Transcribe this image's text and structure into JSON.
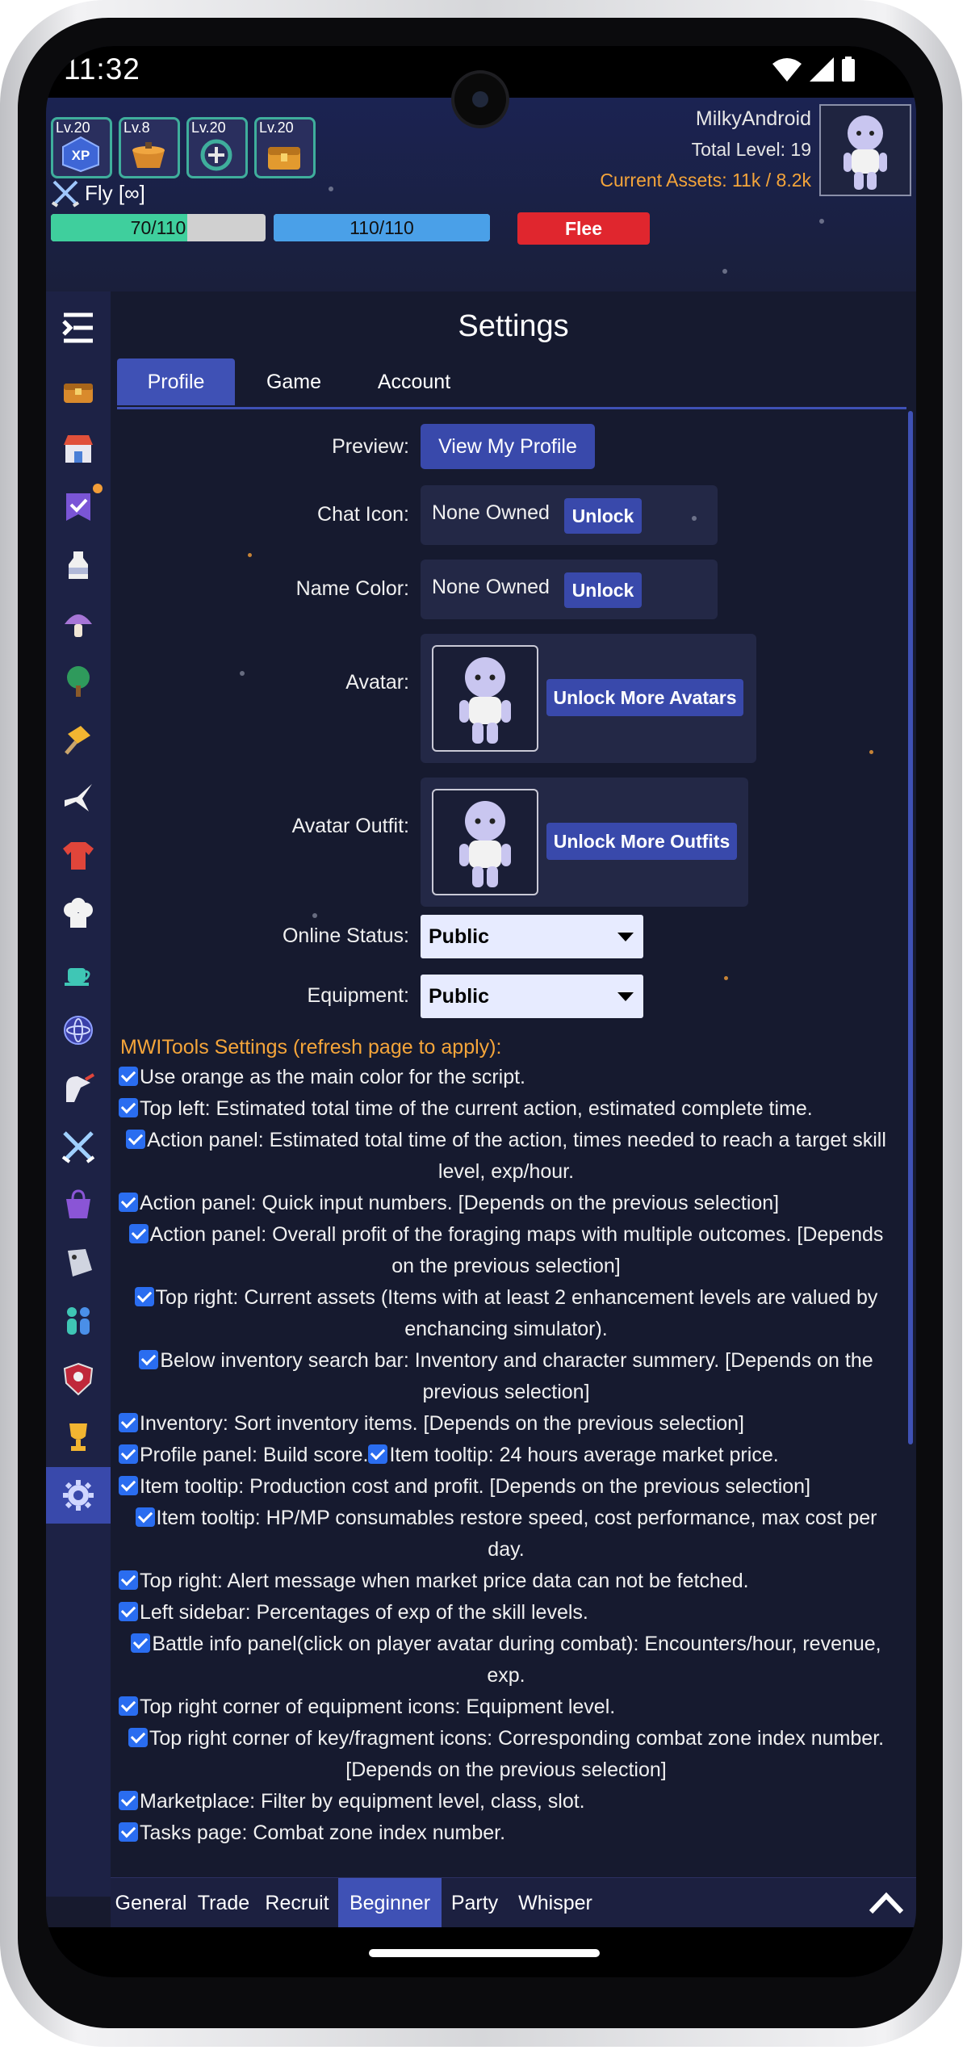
{
  "status_bar": {
    "time": "11:32"
  },
  "skills": [
    {
      "level": "Lv.20",
      "icon": "xp-icon"
    },
    {
      "level": "Lv.8",
      "icon": "cooking-pot-icon"
    },
    {
      "level": "Lv.20",
      "icon": "loop-arrow-icon"
    },
    {
      "level": "Lv.20",
      "icon": "treasure-chest-icon"
    }
  ],
  "player": {
    "name": "MilkyAndroid",
    "total_level": "Total Level: 19",
    "assets": "Current Assets: 11k / 8.2k"
  },
  "action": {
    "label": "Fly [∞]"
  },
  "bars": {
    "hp_text": "70/110",
    "hp_fraction": 0.636,
    "mp_text": "110/110",
    "mp_fraction": 1.0,
    "flee_label": "Flee"
  },
  "sidebar": [
    {
      "icon": "menu-collapse-icon"
    },
    {
      "icon": "inventory-chest-icon"
    },
    {
      "icon": "marketplace-icon"
    },
    {
      "icon": "tasks-banner-icon",
      "badge": true
    },
    {
      "icon": "milking-icon"
    },
    {
      "icon": "foraging-icon"
    },
    {
      "icon": "woodcutting-icon"
    },
    {
      "icon": "cheesesmithing-icon"
    },
    {
      "icon": "crafting-icon"
    },
    {
      "icon": "tailoring-icon"
    },
    {
      "icon": "cooking-icon"
    },
    {
      "icon": "brewing-icon"
    },
    {
      "icon": "alchemy-icon"
    },
    {
      "icon": "enhancing-icon"
    },
    {
      "icon": "combat-icon"
    },
    {
      "icon": "shop-icon"
    },
    {
      "icon": "cowbell-store-icon"
    },
    {
      "icon": "social-icon"
    },
    {
      "icon": "guild-icon"
    },
    {
      "icon": "leaderboard-icon"
    },
    {
      "icon": "settings-gear-icon",
      "active": true
    }
  ],
  "settings": {
    "title": "Settings",
    "tabs": [
      "Profile",
      "Game",
      "Account"
    ],
    "preview_label": "Preview:",
    "view_profile_button": "View My Profile",
    "chat_icon_label": "Chat Icon:",
    "chat_icon_value": "None Owned",
    "name_color_label": "Name Color:",
    "name_color_value": "None Owned",
    "unlock_label": "Unlock",
    "avatar_label": "Avatar:",
    "unlock_avatars_button": "Unlock More Avatars",
    "avatar_outfit_label": "Avatar Outfit:",
    "unlock_outfits_button": "Unlock More Outfits",
    "online_status_label": "Online Status:",
    "online_status_value": "Public",
    "equipment_label": "Equipment:",
    "equipment_value": "Public"
  },
  "mwitools": {
    "title": "MWITools Settings (refresh page to apply):",
    "options": [
      "Use orange as the main color for the script.",
      "Top left: Estimated total time of the current action, estimated complete time.",
      "Action panel: Estimated total time of the action, times needed to reach a target skill level, exp/hour.",
      "Action panel: Quick input numbers. [Depends on the previous selection]",
      "Action panel: Overall profit of the foraging maps with multiple outcomes. [Depends on the previous selection]",
      "Top right: Current assets (Items with at least 2 enhancement levels are valued by enchancing simulator).",
      "Below inventory search bar: Inventory and character summery. [Depends on the previous selection]",
      "Inventory: Sort inventory items. [Depends on the previous selection]",
      "Profile panel: Build score.",
      "Item tooltip: 24 hours average market price.",
      "Item tooltip: Production cost and profit. [Depends on the previous selection]",
      "Item tooltip: HP/MP consumables restore speed, cost performance, max cost per day.",
      "Top right: Alert message when market price data can not be fetched.",
      "Left sidebar: Percentages of exp of the skill levels.",
      "Battle info panel(click on player avatar during combat): Encounters/hour, revenue, exp.",
      "Top right corner of equipment icons: Equipment level.",
      "Top right corner of key/fragment icons: Corresponding combat zone index number. [Depends on the previous selection]",
      "Marketplace: Filter by equipment level, class, slot.",
      "Tasks page: Combat zone index number."
    ]
  },
  "chat_tabs": [
    "General",
    "Trade",
    "Recruit",
    "Beginner",
    "Party",
    "Whisper"
  ],
  "chat_active_tab": "Beginner"
}
